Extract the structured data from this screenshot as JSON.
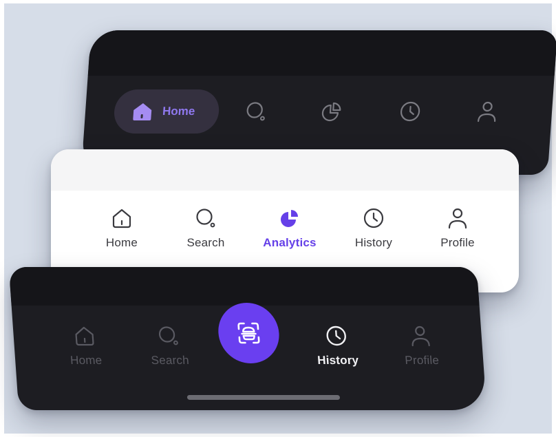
{
  "colors": {
    "backdrop": "#d6dde8",
    "dark_bar": "#1d1d22",
    "light_bar": "#ffffff",
    "accent": "#6a3ff0",
    "accent_text": "#6540e8",
    "pill_bg": "#34303f"
  },
  "top_bar": {
    "active_item": {
      "label": "Home",
      "icon": "home-icon"
    },
    "items": [
      {
        "icon": "search-icon"
      },
      {
        "icon": "analytics-icon"
      },
      {
        "icon": "history-icon"
      },
      {
        "icon": "profile-icon"
      }
    ]
  },
  "middle_bar": {
    "items": [
      {
        "label": "Home",
        "icon": "home-icon"
      },
      {
        "label": "Search",
        "icon": "search-icon"
      },
      {
        "label": "Analytics",
        "icon": "analytics-icon",
        "active": true
      },
      {
        "label": "History",
        "icon": "history-icon"
      },
      {
        "label": "Profile",
        "icon": "profile-icon"
      }
    ]
  },
  "bottom_bar": {
    "items": [
      {
        "label": "Home",
        "icon": "home-icon"
      },
      {
        "label": "Search",
        "icon": "search-icon"
      },
      {
        "label": "History",
        "icon": "history-icon",
        "active": true
      },
      {
        "label": "Profile",
        "icon": "profile-icon"
      }
    ],
    "fab": {
      "icon": "scan-icon"
    }
  }
}
